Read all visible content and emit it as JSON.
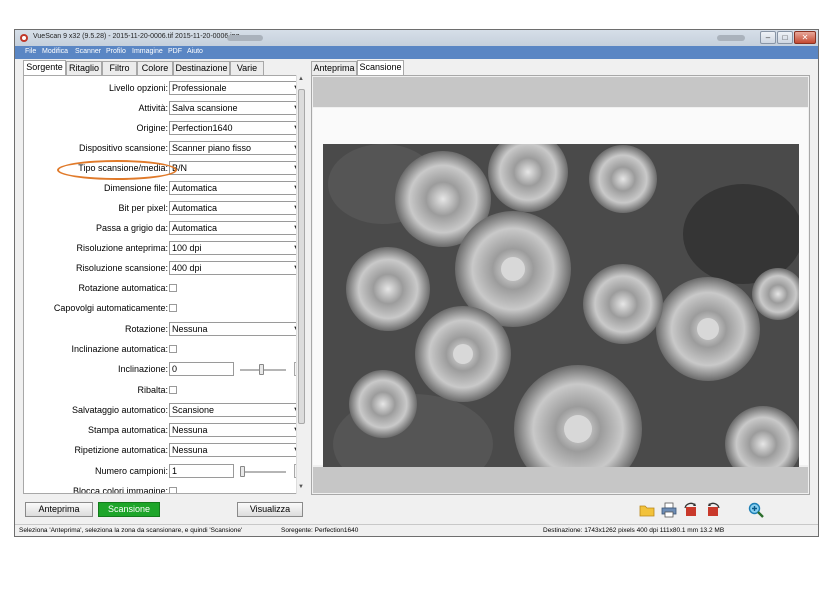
{
  "window": {
    "title": "VueScan 9 x32 (9.5.28) - 2015-11-20-0006.tif 2015-11-20-0006.jpg",
    "controls": [
      "–",
      "□",
      "✕"
    ]
  },
  "menu": [
    "File",
    "Modifica",
    "Scanner",
    "Profilo",
    "Immagine",
    "PDF",
    "Aiuto"
  ],
  "left_tabs": [
    "Sorgente",
    "Ritaglio",
    "Filtro",
    "Colore",
    "Destinazione",
    "Varie"
  ],
  "right_tabs": [
    "Anteprima",
    "Scansione"
  ],
  "settings": [
    {
      "label": "Livello opzioni:",
      "type": "combo",
      "value": "Professionale"
    },
    {
      "label": "Attività:",
      "type": "combo",
      "value": "Salva scansione"
    },
    {
      "label": "Origine:",
      "type": "combo",
      "value": "Perfection1640"
    },
    {
      "label": "Dispositivo scansione:",
      "type": "combo",
      "value": "Scanner piano fisso"
    },
    {
      "label": "Tipo scansione/media:",
      "type": "combo",
      "value": "B/N"
    },
    {
      "label": "Dimensione file:",
      "type": "combo",
      "value": "Automatica"
    },
    {
      "label": "Bit per pixel:",
      "type": "combo",
      "value": "Automatica"
    },
    {
      "label": "Passa a grigio da:",
      "type": "combo",
      "value": "Automatica"
    },
    {
      "label": "Risoluzione anteprima:",
      "type": "combo",
      "value": "100 dpi"
    },
    {
      "label": "Risoluzione scansione:",
      "type": "combo",
      "value": "400 dpi"
    },
    {
      "label": "Rotazione automatica:",
      "type": "check",
      "value": ""
    },
    {
      "label": "Capovolgi automaticamente:",
      "type": "check",
      "value": ""
    },
    {
      "label": "Rotazione:",
      "type": "combo",
      "value": "Nessuna"
    },
    {
      "label": "Inclinazione automatica:",
      "type": "check",
      "value": ""
    },
    {
      "label": "Inclinazione:",
      "type": "slider",
      "value": "0"
    },
    {
      "label": "Ribalta:",
      "type": "check",
      "value": ""
    },
    {
      "label": "Salvataggio automatico:",
      "type": "combo",
      "value": "Scansione"
    },
    {
      "label": "Stampa automatica:",
      "type": "combo",
      "value": "Nessuna"
    },
    {
      "label": "Ripetizione automatica:",
      "type": "combo",
      "value": "Nessuna"
    },
    {
      "label": "Numero campioni:",
      "type": "slider",
      "value": "1"
    },
    {
      "label": "Blocca colori immagine:",
      "type": "check",
      "value": ""
    }
  ],
  "buttons": {
    "preview": "Anteprima",
    "scan": "Scansione",
    "view": "Visualizza"
  },
  "status": {
    "hint": "Seleziona 'Anteprima', seleziona la zona da scansionare, e quindi 'Scansione'",
    "source": "Soregente: Perfection1640",
    "destination": "Destinazione: 1743x1262 pixels 400 dpi 111x80.1 mm 13.2 MB"
  },
  "icons": [
    "folder-icon",
    "printer-icon",
    "rotate-left-icon",
    "rotate-right-icon",
    "zoom-in-icon"
  ],
  "colors": {
    "menubar": "#5a86c4",
    "scan_button": "#1ea52a",
    "highlight": "#e07a2a"
  }
}
